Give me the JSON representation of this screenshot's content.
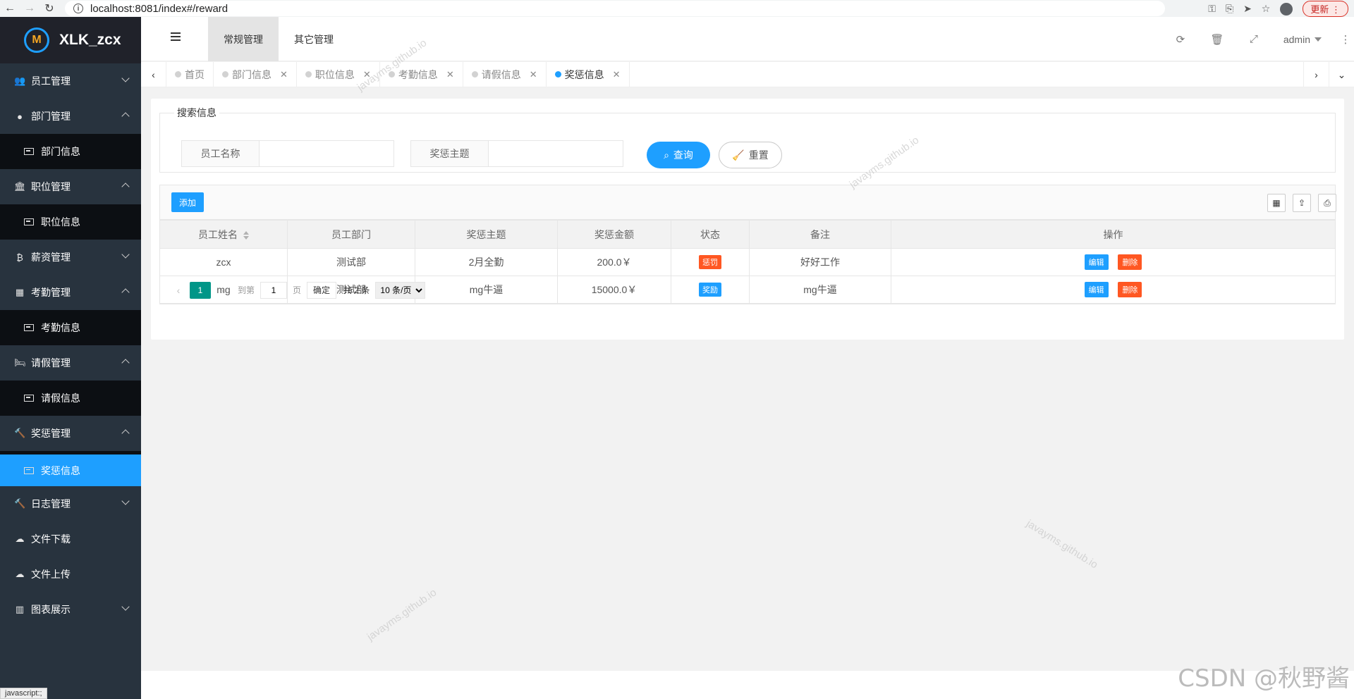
{
  "browser": {
    "url": "localhost:8081/index#/reward",
    "update_label": "更新"
  },
  "app": {
    "name": "XLK_zcx"
  },
  "sidebar": {
    "items": [
      {
        "label": "员工管理",
        "icon": "users-icon",
        "expanded": false
      },
      {
        "label": "部门管理",
        "icon": "user-icon",
        "expanded": true,
        "children": [
          "部门信息"
        ]
      },
      {
        "label": "职位管理",
        "icon": "bank-icon",
        "expanded": true,
        "children": [
          "职位信息"
        ]
      },
      {
        "label": "薪资管理",
        "icon": "bitcoin-icon",
        "expanded": false
      },
      {
        "label": "考勤管理",
        "icon": "calendar-icon",
        "expanded": true,
        "children": [
          "考勤信息"
        ]
      },
      {
        "label": "请假管理",
        "icon": "bed-icon",
        "expanded": true,
        "children": [
          "请假信息"
        ]
      },
      {
        "label": "奖惩管理",
        "icon": "gavel-icon",
        "expanded": true,
        "children": [
          "奖惩信息"
        ]
      },
      {
        "label": "日志管理",
        "icon": "gavel-icon",
        "expanded": false
      },
      {
        "label": "文件下载",
        "icon": "cloud-download-icon"
      },
      {
        "label": "文件上传",
        "icon": "cloud-upload-icon"
      },
      {
        "label": "图表展示",
        "icon": "bar-chart-icon",
        "expanded": false
      }
    ]
  },
  "header": {
    "tabs": [
      "常规管理",
      "其它管理"
    ],
    "active_tab": "常规管理",
    "user": "admin"
  },
  "tabbar": {
    "tabs": [
      {
        "label": "首页",
        "closable": false
      },
      {
        "label": "部门信息",
        "closable": true
      },
      {
        "label": "职位信息",
        "closable": true
      },
      {
        "label": "考勤信息",
        "closable": true
      },
      {
        "label": "请假信息",
        "closable": true
      },
      {
        "label": "奖惩信息",
        "closable": true,
        "active": true
      }
    ]
  },
  "search": {
    "legend": "搜索信息",
    "name_label": "员工名称",
    "name_value": "",
    "topic_label": "奖惩主题",
    "topic_value": "",
    "query_label": "查询",
    "reset_label": "重置"
  },
  "toolbar": {
    "add_label": "添加"
  },
  "table": {
    "columns": [
      "员工姓名",
      "员工部门",
      "奖惩主题",
      "奖惩金额",
      "状态",
      "备注",
      "操作"
    ],
    "rows": [
      {
        "name": "zcx",
        "dept": "测试部",
        "topic": "2月全勤",
        "amount": "200.0￥",
        "status": "惩罚",
        "status_type": "penalty",
        "note": "好好工作"
      },
      {
        "name": "mg",
        "dept": "测试部",
        "topic": "mg牛逼",
        "amount": "15000.0￥",
        "status": "奖励",
        "status_type": "reward",
        "note": "mg牛逼"
      }
    ],
    "edit_label": "编辑",
    "delete_label": "删除"
  },
  "pager": {
    "current": "1",
    "goto_label": "到第",
    "goto_value": "1",
    "page_label": "页",
    "confirm_label": "确定",
    "total_label": "共 2 条",
    "page_size": "10 条/页"
  },
  "watermark": "javayms.github.io",
  "credit": "CSDN @秋野酱",
  "status_tip": "javascript:;",
  "colors": {
    "primary": "#1e9fff",
    "danger": "#ff5722",
    "pager_active": "#009688",
    "sidebar": "#28333e"
  }
}
